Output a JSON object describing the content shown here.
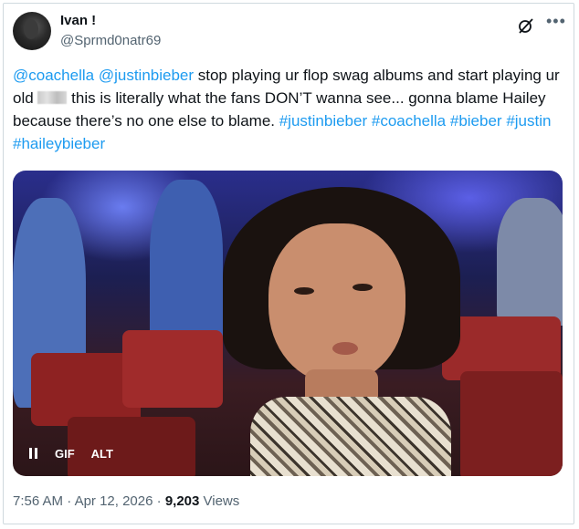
{
  "author": {
    "name": "Ivan !",
    "handle": "@Sprmd0natr69"
  },
  "tweet": {
    "mention1": "@coachella",
    "mention2": "@justinbieber",
    "text1": " stop playing ur flop swag albums and start playing ur old ",
    "text2": " this is literally what the fans DON’T wanna see... gonna blame Hailey because there’s no one else to blame. ",
    "hashtags": [
      "#justinbieber",
      "#coachella",
      "#bieber",
      "#justin",
      "#haileybieber"
    ]
  },
  "media": {
    "pause_icon": "pause-icon",
    "gif_label": "GIF",
    "alt_label": "ALT"
  },
  "footer": {
    "time": "7:56 AM",
    "separator1": " · ",
    "date": "Apr 12, 2026",
    "separator2": " · ",
    "views_count": "9,203",
    "views_label": " Views"
  },
  "colors": {
    "link": "#1d9bf0",
    "muted": "#536471",
    "text": "#0f1419"
  },
  "icons": [
    "grok-icon",
    "more-icon"
  ]
}
